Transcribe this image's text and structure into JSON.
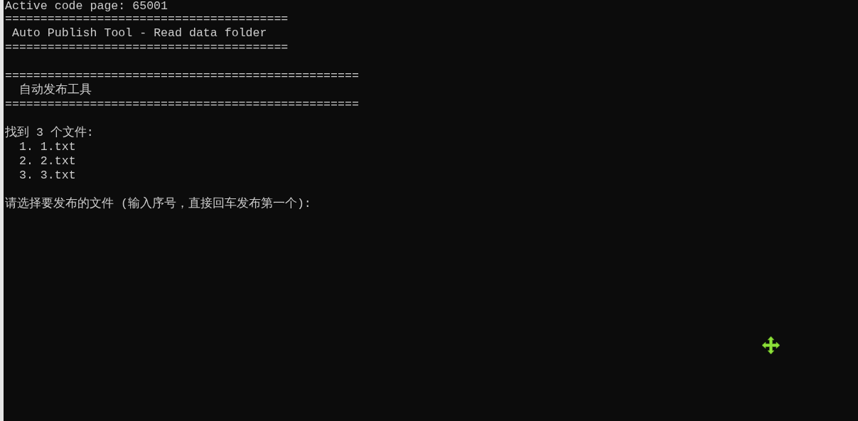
{
  "console": {
    "lines": [
      {
        "kind": "text",
        "text": "Active code page: 65001"
      },
      {
        "kind": "rule",
        "text": "========================================"
      },
      {
        "kind": "title",
        "text": "Auto Publish Tool - Read data folder"
      },
      {
        "kind": "rule",
        "text": "========================================"
      },
      {
        "kind": "blank"
      },
      {
        "kind": "rule",
        "text": "=================================================="
      },
      {
        "kind": "subtitle",
        "text": "自动发布工具"
      },
      {
        "kind": "rule",
        "text": "=================================================="
      },
      {
        "kind": "blank"
      },
      {
        "kind": "text",
        "text": "找到 3 个文件:"
      },
      {
        "kind": "item",
        "text": "1. 1.txt"
      },
      {
        "kind": "item",
        "text": "2. 2.txt"
      },
      {
        "kind": "item",
        "text": "3. 3.txt"
      },
      {
        "kind": "blank"
      },
      {
        "kind": "text",
        "text": "请选择要发布的文件 (输入序号，直接回车发布第一个):"
      }
    ]
  }
}
